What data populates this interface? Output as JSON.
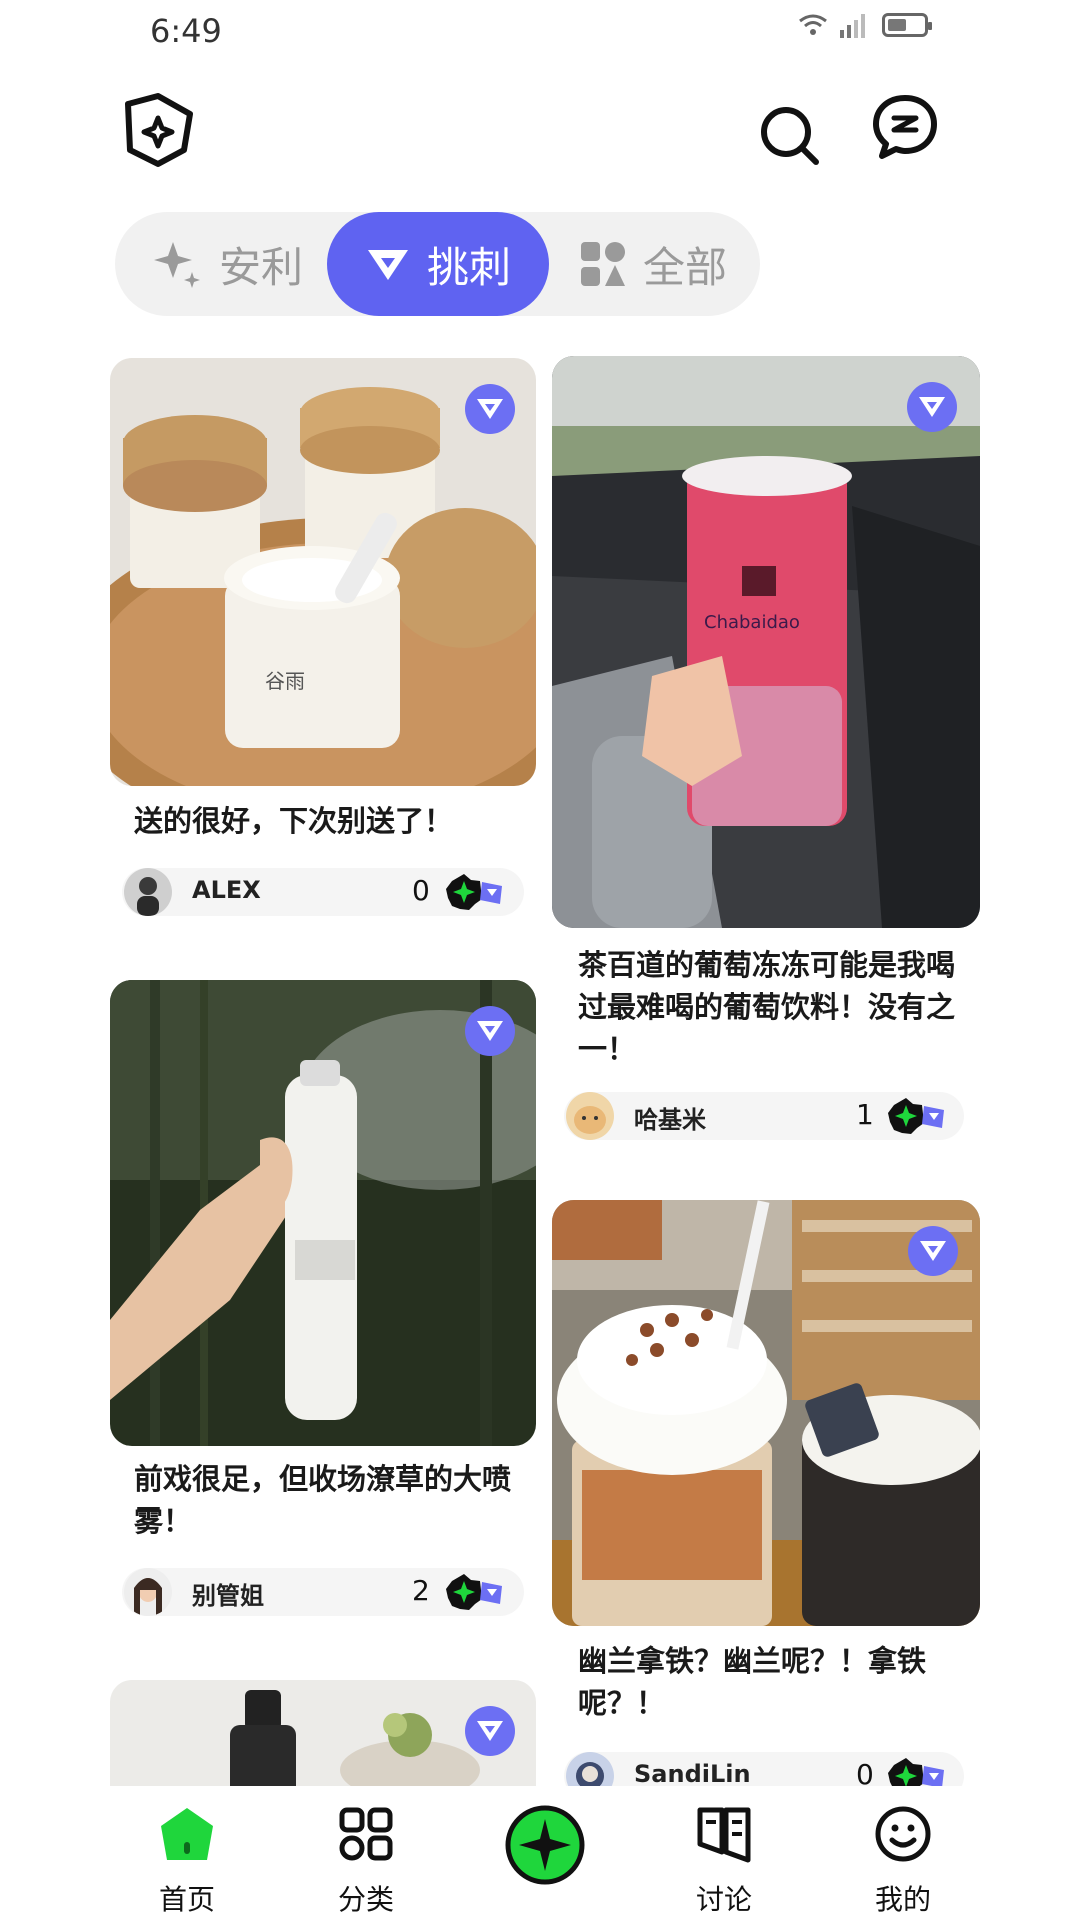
{
  "status_bar": {
    "time": "6:49",
    "network": "4G"
  },
  "tabs": [
    {
      "label": "安利",
      "active": false
    },
    {
      "label": "挑刺",
      "active": true
    },
    {
      "label": "全部",
      "active": false
    }
  ],
  "posts": [
    {
      "title": "送的很好，下次别送了！",
      "author": "ALEX",
      "count": "0"
    },
    {
      "title": "茶百道的葡萄冻冻可能是我喝过最难喝的葡萄饮料！没有之一！",
      "author": "哈基米",
      "count": "1"
    },
    {
      "title": "前戏很足，但收场潦草的大喷雾！",
      "author": "别管姐",
      "count": "2"
    },
    {
      "title": "幽兰拿铁？幽兰呢？！拿铁呢？！",
      "author": "SandiLin",
      "count": "0"
    }
  ],
  "nav": [
    {
      "label": "首页"
    },
    {
      "label": "分类"
    },
    {
      "label": "讨论"
    },
    {
      "label": "我的"
    }
  ],
  "colors": {
    "accent": "#5f63f1",
    "green": "#1fd63c"
  }
}
